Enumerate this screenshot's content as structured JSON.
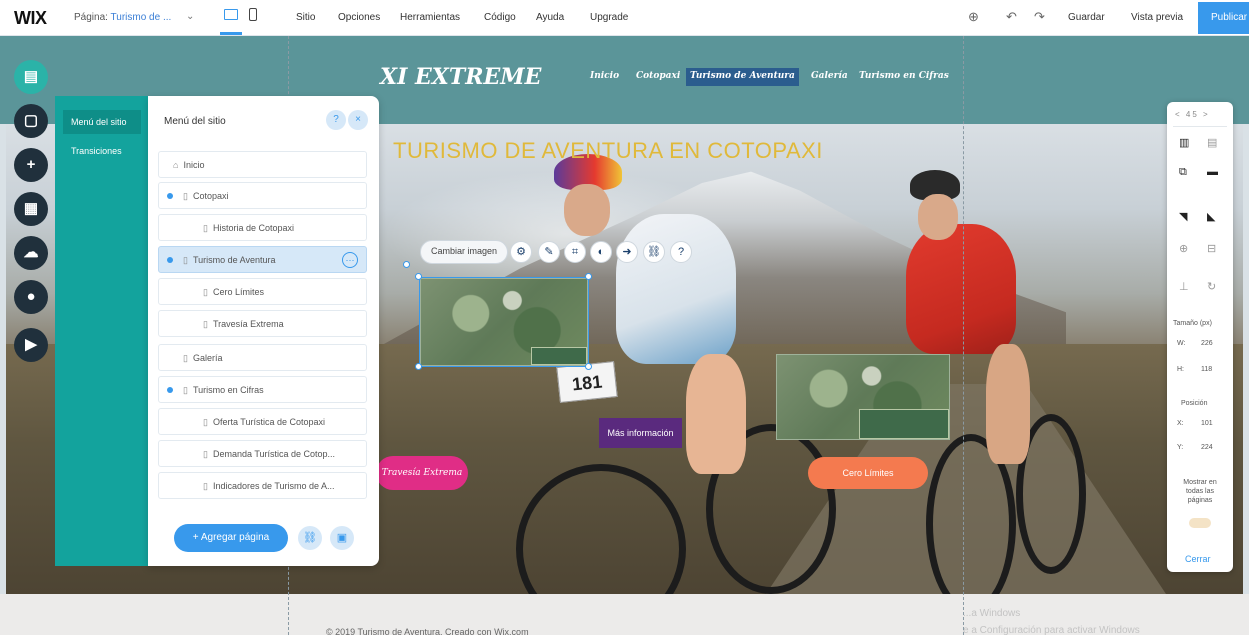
{
  "topbar": {
    "logo": "WIX",
    "page_label": "Página:",
    "page_name": "Turismo de ...",
    "menu": [
      "Sitio",
      "Opciones",
      "Herramientas",
      "Código",
      "Ayuda",
      "Upgrade"
    ],
    "save": "Guardar",
    "preview": "Vista previa",
    "publish": "Publicar"
  },
  "rail": {
    "items": [
      "pages-icon",
      "background-icon",
      "add-icon",
      "apps-icon",
      "upload-icon",
      "blog-icon",
      "video-icon"
    ]
  },
  "site_menu": {
    "tabs": [
      "Menú del sitio",
      "Transiciones"
    ],
    "title": "Menú del sitio",
    "pages": [
      {
        "label": "Inicio",
        "level": 0
      },
      {
        "label": "Cotopaxi",
        "level": 0
      },
      {
        "label": "Historia de Cotopaxi",
        "level": 1
      },
      {
        "label": "Turismo de Aventura",
        "level": 0
      },
      {
        "label": "Cero Límites",
        "level": 1
      },
      {
        "label": "Travesía Extrema",
        "level": 1
      },
      {
        "label": "Galería",
        "level": 0
      },
      {
        "label": "Turismo en Cifras",
        "level": 0
      },
      {
        "label": "Oferta Turística de Cotopaxi",
        "level": 1
      },
      {
        "label": "Demanda Turística de Cotop...",
        "level": 1
      },
      {
        "label": "Indicadores de Turismo de A...",
        "level": 1
      }
    ],
    "add_page": "+ Agregar página"
  },
  "site": {
    "title": "XI EXTREME",
    "nav": [
      "Inicio",
      "Cotopaxi",
      "Turismo de Aventura",
      "Galería",
      "Turismo en Cifras"
    ],
    "hero_heading": "TURISMO DE AVENTURA EN COTOPAXI",
    "bib_number": "181",
    "btn_more": "Más información",
    "btn_pink": "Travesía Extrema",
    "btn_orange": "Cero Límites",
    "change_image": "Cambiar imagen",
    "footer": "© 2019 Turismo de Aventura. Creado con Wix.com",
    "footer_note_1": "...a Windows",
    "footer_note_2": "e a Configuración para activar Windows"
  },
  "inspector": {
    "top": "< 45 >",
    "size_label": "Tamaño (px)",
    "w_label": "W:",
    "w_value": "226",
    "h_label": "H:",
    "h_value": "118",
    "pos_label": "Posición",
    "x_label": "X:",
    "x_value": "101",
    "y_label": "Y:",
    "y_value": "224",
    "show_all": "Mostrar en todas las páginas",
    "close": "Cerrar"
  }
}
